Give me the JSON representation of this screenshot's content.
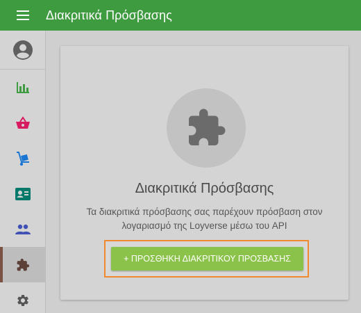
{
  "header": {
    "title": "Διακριτικά Πρόσβασης",
    "menu_icon": "menu-icon"
  },
  "sidebar": {
    "items": [
      {
        "name": "account",
        "icon": "account-circle-icon",
        "color": "#555555"
      },
      {
        "name": "reports",
        "icon": "bar-chart-icon",
        "color": "#3f9b3f"
      },
      {
        "name": "items",
        "icon": "basket-icon",
        "color": "#d81b60"
      },
      {
        "name": "inventory",
        "icon": "dolly-icon",
        "color": "#1976d2"
      },
      {
        "name": "employees",
        "icon": "badge-card-icon",
        "color": "#00796b"
      },
      {
        "name": "customers",
        "icon": "people-icon",
        "color": "#3f51b5"
      },
      {
        "name": "integrations",
        "icon": "puzzle-icon",
        "color": "#5d4037",
        "active": true
      },
      {
        "name": "settings",
        "icon": "gear-icon",
        "color": "#555555"
      }
    ]
  },
  "card": {
    "icon": "puzzle-icon",
    "title": "Διακριτικά Πρόσβασης",
    "description": "Τα διακριτικά πρόσβασης σας παρέχουν πρόσβαση στον λογαριασμό της Loyverse μέσω του API",
    "add_button_label": "+ ΠΡΟΣΘΗΚΗ ΔΙΑΚΡΙΤΙΚΟΥ ΠΡΟΣΒΑΣΗΣ"
  },
  "colors": {
    "header": "#3f9b3f",
    "button": "#8bc34a",
    "highlight": "#ef8a2e"
  }
}
